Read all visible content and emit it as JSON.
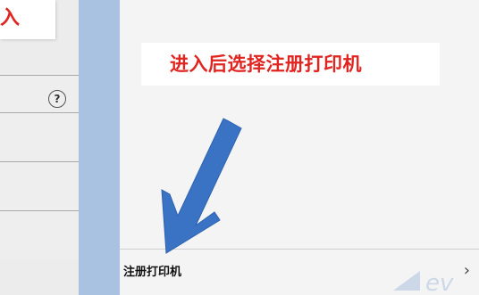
{
  "left_panel": {
    "callout_text": "入",
    "help_icon": "question-circle-icon"
  },
  "annotation": {
    "instruction": "进入后选择注册打印机",
    "color": "#e0241f",
    "arrow_color": "#3a72c4"
  },
  "settings_list": {
    "register_printer_label": "注册打印机",
    "chevron": "›"
  }
}
